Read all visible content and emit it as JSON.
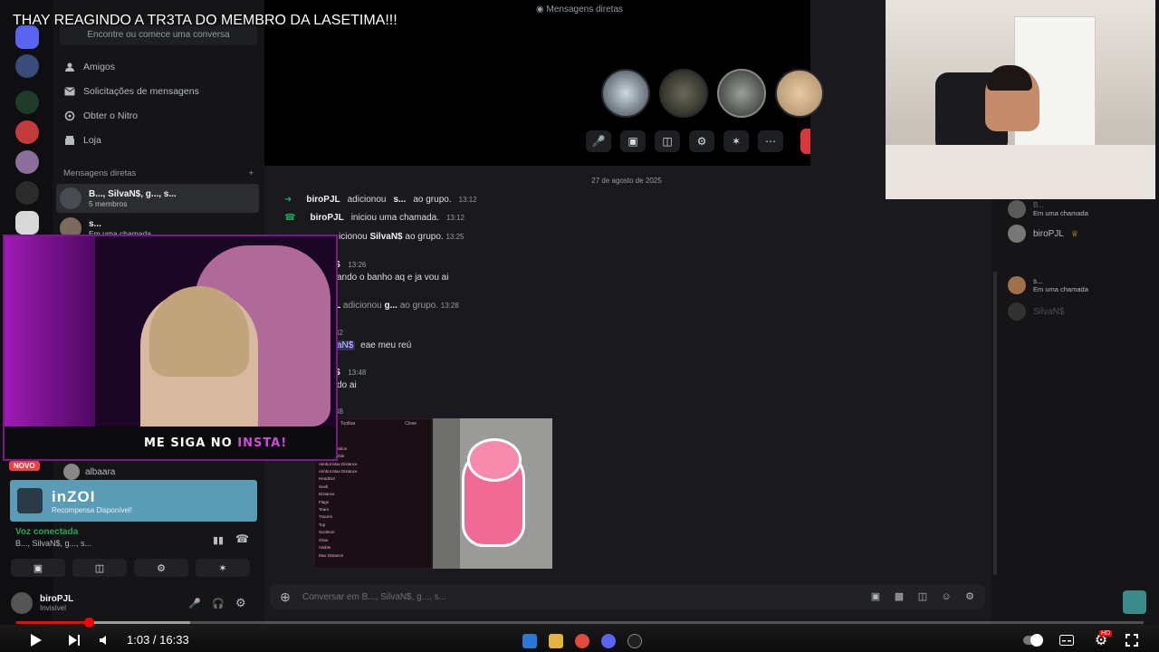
{
  "video": {
    "title": "THAY REAGINDO A TR3TA DO MEMBRO DA LASETIMA!!!",
    "time_display": "1:03 / 16:33",
    "progress": 0.064,
    "hd_badge": "HD"
  },
  "overlay": {
    "follow_prefix": "ME SIGA NO ",
    "follow_accent": "INSTA!"
  },
  "discord": {
    "search_placeholder": "Encontre ou comece uma conversa",
    "nav": [
      {
        "label": "Amigos",
        "icon": "friends-icon"
      },
      {
        "label": "Solicitações de mensagens",
        "icon": "mail-icon"
      },
      {
        "label": "Obter o Nitro",
        "icon": "nitro-icon"
      },
      {
        "label": "Loja",
        "icon": "shop-icon"
      }
    ],
    "dm_section_title": "Mensagens diretas",
    "dm_add": "+",
    "dms": [
      {
        "name": "B..., SilvaN$, g..., s...",
        "sub": "5 membros"
      },
      {
        "name": "s...",
        "sub": "Em uma chamada"
      }
    ],
    "novo_badge": "NOVO",
    "partial_dm": "albaara",
    "promo": {
      "logo": "inZOI",
      "sub": "Recompensa Disponível!"
    },
    "voice": {
      "status": "Voz conectada",
      "channel": "B..., SilvaN$, g..., s..."
    },
    "user": {
      "name": "biroPJL",
      "status": "Invisível"
    },
    "call_header": "Mensagens diretas",
    "date_divider": "27 de agosto de 2025",
    "messages": [
      {
        "who": "biroPJL",
        "text": "adicionou",
        "target": "s...",
        "rest": "ao grupo.",
        "time": "13:12",
        "icon": "arrow-right-icon"
      },
      {
        "who": "biroPJL",
        "text": "iniciou uma chamada.",
        "time": "13:12",
        "icon": "phone-icon"
      }
    ],
    "partial_lines": {
      "l1_text": "icionou",
      "l1_mention": "SilvaN$",
      "l1_rest": "ao grupo.",
      "l1_time": "13:25",
      "l2_name": "$",
      "l2_time": "13:26",
      "l3_text": "ando o banho aq e ja vou ai",
      "l4_name": "L",
      "l4_text": "adicionou",
      "l4_target": "g...",
      "l4_rest": "ao grupo.",
      "l4_time": "13:28",
      "l5_time": "42",
      "l6_mention": "aN$",
      "l6_text": "eae meu reú",
      "l7_name": "$",
      "l7_time": "13:48",
      "l8_text": "do ai",
      "l9_time": "48"
    },
    "composer_placeholder": "Conversar em B..., SilvaN$, g..., s...",
    "members": [
      {
        "name": "B...",
        "sub": "Em uma chamada"
      },
      {
        "name": "biroPJL",
        "sub": ""
      },
      {
        "name": "s...",
        "sub": "Em uma chamada"
      },
      {
        "name": "SilvaN$",
        "sub": ""
      }
    ],
    "game_menu": {
      "header_left": "Toolbar",
      "header_right": "Close",
      "lines": [
        "Bot Silent",
        "Visible",
        "Aimbot Position",
        "Aimbot Visible",
        "Aimbot Max Distance",
        "Aimbot Max Distance",
        "HeadDot",
        "Snell",
        "Distance",
        "Flags",
        "Team",
        "Tracers",
        "Top",
        "Sceleton",
        "Glow",
        "Visible",
        "Max Distance"
      ]
    }
  }
}
